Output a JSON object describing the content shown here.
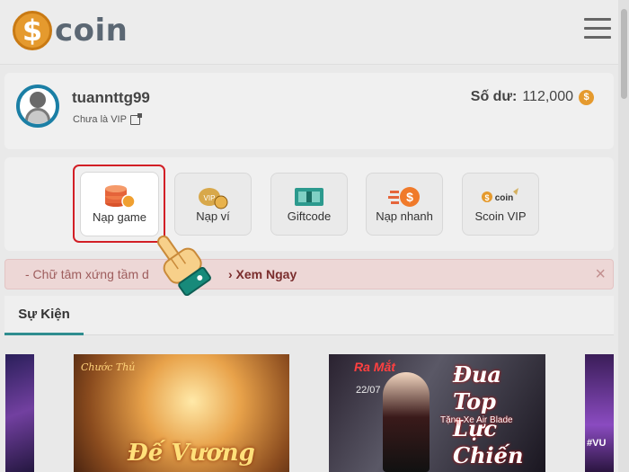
{
  "header": {
    "logo_symbol": "$",
    "logo_text": "coin",
    "menu_icon": "hamburger-icon",
    "brand_color": "#e59a2e"
  },
  "user": {
    "username": "tuannttg99",
    "vip_status": "Chưa là VIP",
    "balance_label": "Số dư:",
    "balance_value": "112,000",
    "coin_symbol": "$"
  },
  "actions": [
    {
      "label": "Nạp game",
      "icon": "coin-stack-icon",
      "selected": true
    },
    {
      "label": "Nạp ví",
      "icon": "wallet-coins-icon",
      "selected": false
    },
    {
      "label": "Giftcode",
      "icon": "gift-card-icon",
      "selected": false
    },
    {
      "label": "Nạp nhanh",
      "icon": "fast-coin-icon",
      "selected": false
    },
    {
      "label": "Scoin VIP",
      "icon": "scoin-vip-icon",
      "selected": false
    }
  ],
  "notice": {
    "text": "- Chữ tâm xứng tầm d",
    "link_label": "› Xem Ngay",
    "close_symbol": "×"
  },
  "events": {
    "tab_label": "Sự Kiện",
    "accent_color": "#2f8d8f"
  },
  "banners": [
    {
      "badge": "Chước Thủ",
      "title": "Đế Vương"
    },
    {
      "top_text": "Ra Mắt",
      "date": "22/07",
      "title": "Đua Top Lực Chiến",
      "subtitle": "Tặng Xe Air Blade"
    },
    {
      "tag": "#VU"
    }
  ]
}
